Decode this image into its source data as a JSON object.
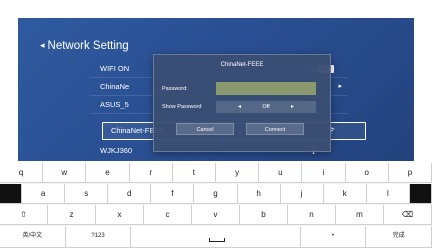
{
  "screen": {
    "back_icon": "chevron-left-icon",
    "title": "Network Setting",
    "rows": [
      {
        "label": "WIFI ON",
        "control": "toggle"
      },
      {
        "label": "ChinaNe",
        "control": "wifi-chevron"
      },
      {
        "label": "ASUS_5",
        "control": "wifi"
      },
      {
        "label": "ChinaNet-FEEE",
        "control": "wifi",
        "focused": true
      },
      {
        "label": "WJKJ360",
        "control": "wifi"
      }
    ]
  },
  "dialog": {
    "title": "ChinaNet-FEEE",
    "password_label": "Password:",
    "password_value": "",
    "show_password_label": "Show Password",
    "show_password_value": "Off",
    "cancel_label": "Cancel",
    "connect_label": "Connect"
  },
  "keyboard": {
    "row1": [
      "q",
      "w",
      "e",
      "r",
      "t",
      "y",
      "u",
      "i",
      "o",
      "p"
    ],
    "row2": [
      "a",
      "s",
      "d",
      "f",
      "g",
      "h",
      "j",
      "k",
      "l"
    ],
    "row3": [
      "z",
      "x",
      "c",
      "v",
      "b",
      "n",
      "m"
    ],
    "shift_icon": "shift-icon",
    "backspace_icon": "backspace-icon",
    "lang_label": "英/中文",
    "num_label": "?123",
    "dot_label": "•",
    "done_label": "完成"
  },
  "colors": {
    "tv_bg": "#2a4f92",
    "dialog_bg": "#3a4e72",
    "password_field": "#8a9a6e",
    "dark_key": "#111111"
  }
}
